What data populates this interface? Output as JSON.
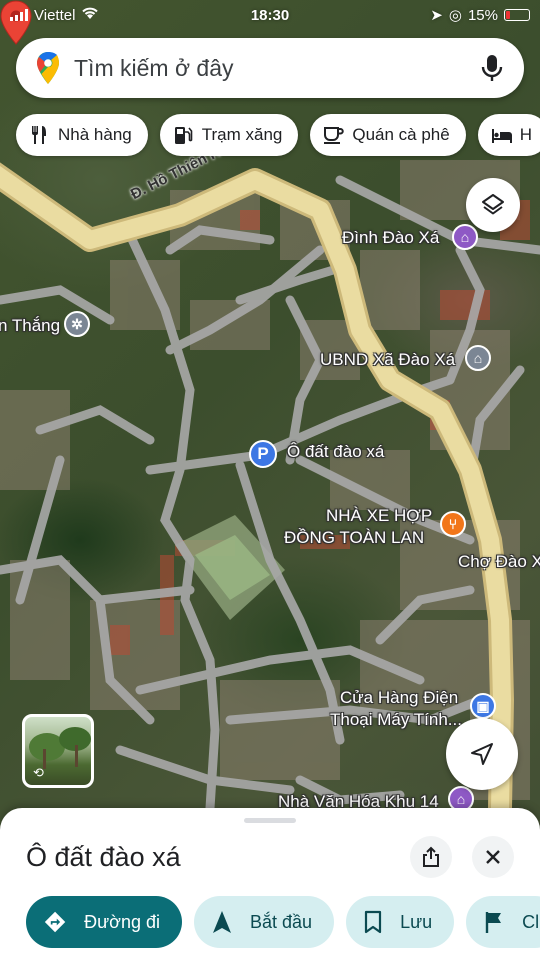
{
  "status_bar": {
    "carrier": "Viettel",
    "time": "18:30",
    "battery": "15%"
  },
  "search": {
    "placeholder": "Tìm kiếm ở đây"
  },
  "chips": [
    {
      "label": "Nhà hàng",
      "icon": "restaurant-icon"
    },
    {
      "label": "Trạm xăng",
      "icon": "gas-station-icon"
    },
    {
      "label": "Quán cà phê",
      "icon": "coffee-icon"
    },
    {
      "label": "H",
      "icon": "hotel-icon"
    }
  ],
  "map": {
    "road_label": "Đ. Hồ Thiên Hương",
    "selected_place": "Ô đất đào xá",
    "labels": {
      "dinh_dao_xa": "Đình Đào Xá",
      "thang": "n Thắng",
      "ubnd": "UBND Xã Đào Xá",
      "nha_xe_line1": "NHÀ XE HỢP",
      "nha_xe_line2": "ĐỒNG TOÀN LAN",
      "cho_dao_xa": "Chợ Đào X",
      "cua_hang_line1": "Cửa Hàng Điện",
      "cua_hang_line2": "Thoại Máy Tính...",
      "nha_van_hoa": "Nhà Văn Hóa Khu 14"
    }
  },
  "sheet": {
    "title": "Ô đất đào xá",
    "actions": {
      "directions": "Đường đi",
      "start": "Bắt đầu",
      "save": "Lưu",
      "more": "Cl"
    }
  },
  "colors": {
    "primary_teal": "#0b6e77",
    "secondary_bg": "#d5eef0",
    "pin_red": "#ea4335",
    "poi_purple": "#8e59c5",
    "poi_orange": "#f2761a",
    "poi_gray": "#7b8694",
    "poi_blue": "#3d77e4",
    "main_road": "#e8d89c"
  }
}
